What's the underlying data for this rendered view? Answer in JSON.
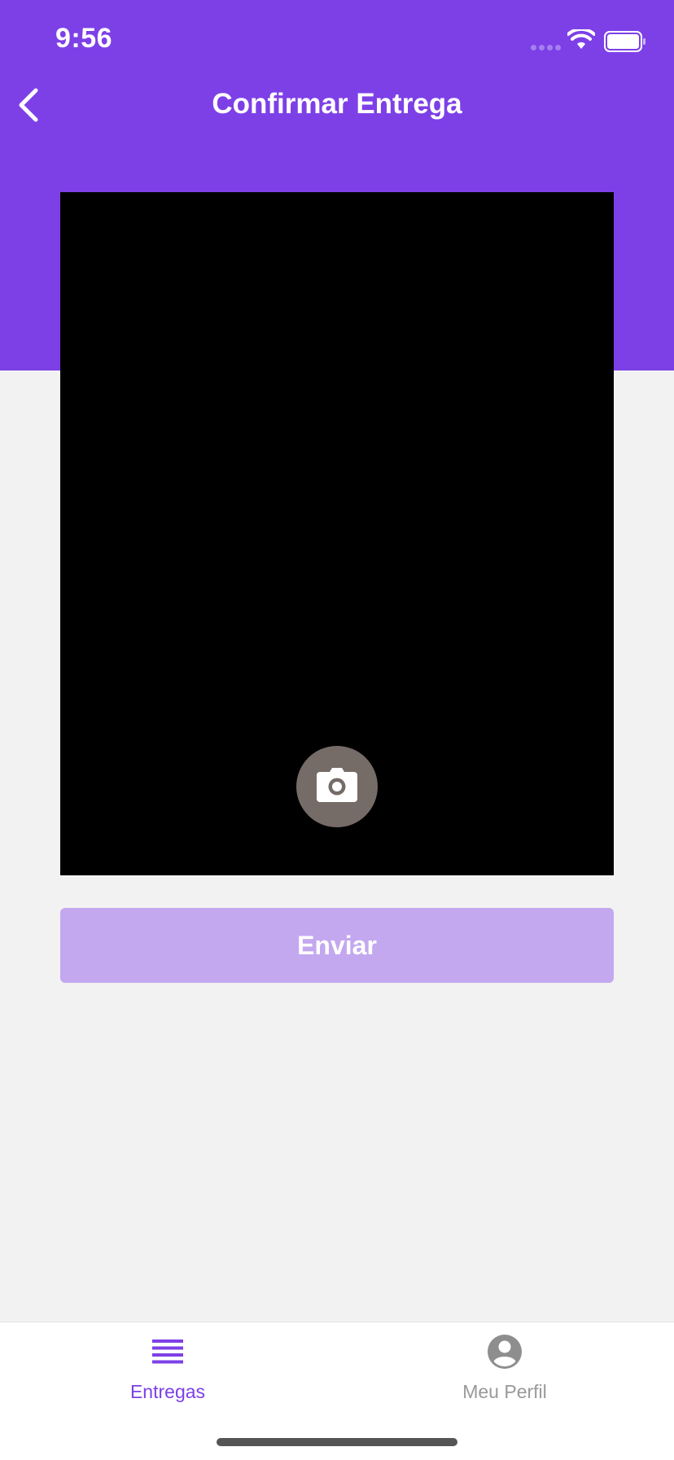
{
  "status_bar": {
    "time": "9:56"
  },
  "header": {
    "title": "Confirmar Entrega",
    "back_icon": "chevron-left-icon"
  },
  "camera": {
    "capture_icon": "camera-icon"
  },
  "form": {
    "send_label": "Enviar"
  },
  "tab_bar": {
    "tabs": [
      {
        "label": "Entregas",
        "icon": "list-icon",
        "active": true
      },
      {
        "label": "Meu Perfil",
        "icon": "account-circle-icon",
        "active": false
      }
    ]
  },
  "colors": {
    "accent": "#7d40e7",
    "button_disabled": "#c3a8ef",
    "background": "#f2f2f2",
    "inactive_tab": "#999999"
  }
}
